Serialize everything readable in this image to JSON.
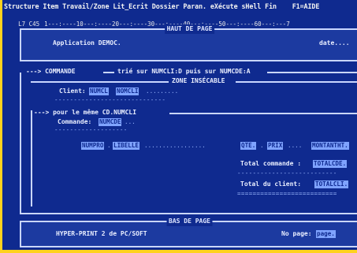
{
  "menu": {
    "bar": "Structure Item Travail/Zone Lit_Ecrit Dossier Paran. eXécute sHell Fin    F1=AIDE"
  },
  "ruler": {
    "pos": "L7 C45",
    "scale": "1---:----10---:----20---:----30---:----40---:----50---:----60---:---7"
  },
  "header_zone": {
    "title": "HAUT DE PAGE",
    "app_label": "Application DEMOC.",
    "date_label": "date...."
  },
  "commande_block": {
    "arrow_label": "---> COMMANDE",
    "sort_text": "trié sur NUMCLI:D puis sur NUMCDE:A",
    "zone_title": "ZONE INSÉCABLE",
    "client_label": "Client:",
    "client_field1": "NUMCL",
    "client_field2": "NOMCLI",
    "client_dots": ".........",
    "pour_label": "---> pour le même CD.NUMCLI",
    "commande_label": "Commande:",
    "commande_field": "NUMCDE",
    "commande_dots": "...",
    "cols": [
      {
        "field": "NUMPRO",
        "dots": "."
      },
      {
        "field": "LIBELLE",
        "dots": "................."
      },
      {
        "field": "QTE.",
        "dots": "."
      },
      {
        "field": "PRIX",
        "dots": "...."
      },
      {
        "field": "MONTANTHT.",
        "dots": ""
      }
    ],
    "total_commande_label": "Total commande :",
    "total_commande_field": "TOTALCDE.",
    "total_client_label": "Total du client:",
    "total_client_field": "TOTALCLI."
  },
  "footer_zone": {
    "title": "BAS DE PAGE",
    "left_text": "HYPER-PRINT 2 de PC/SOFT",
    "page_label": "No page:",
    "page_field": "page."
  }
}
